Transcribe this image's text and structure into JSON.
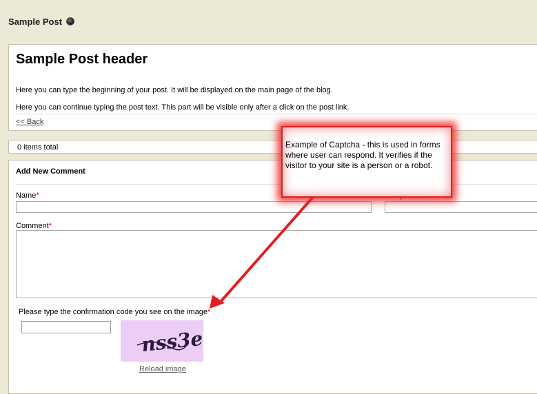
{
  "page": {
    "title": "Sample Post"
  },
  "post": {
    "header": "Sample Post header",
    "intro_text": "Here you can type the beginning of your post. It will be displayed on the main page of the blog.",
    "continued_text": "Here you can continue typing the post text. This part will be visible only after a click on the post link.",
    "back_link": "<< Back"
  },
  "items_total": "0 items total",
  "comment_form": {
    "title": "Add New Comment",
    "name_label": "Name",
    "subject_label": "Subject",
    "comment_label": "Comment",
    "required_marker": "*",
    "name_value": "",
    "subject_value": "",
    "comment_value": "",
    "captcha_label": "Please type the confirmation code you see on the image",
    "captcha_value": "",
    "captcha_text": "nss3e",
    "reload_label": "Reload image"
  },
  "callout": {
    "text": "Example of Captcha - this is used in forms where user can respond.  It verifies if the visitor to your site is a person or a robot.",
    "color": "#e02020"
  },
  "colors": {
    "background": "#ece9d6",
    "panel": "#ffffff",
    "captcha_bg": "#eccdf5",
    "required": "#cc0000"
  }
}
